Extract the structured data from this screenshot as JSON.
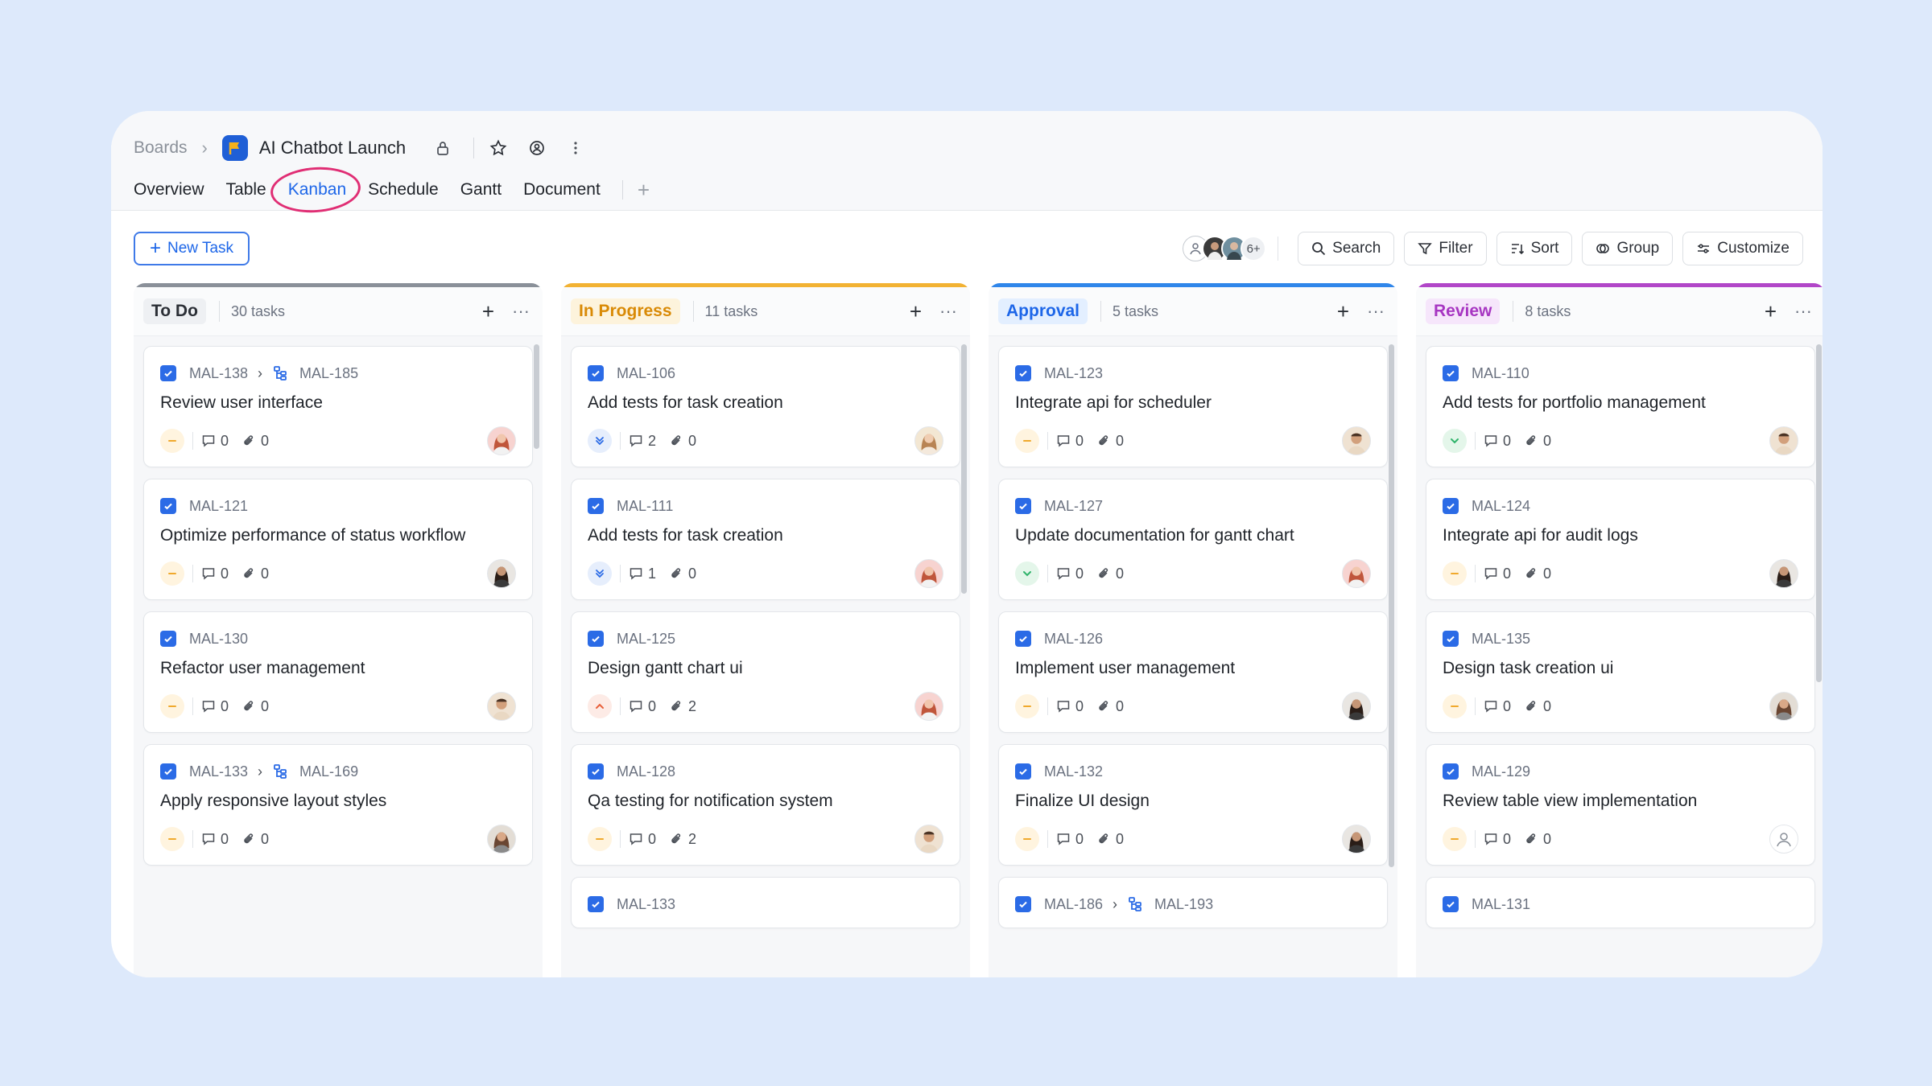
{
  "header": {
    "breadcrumb_root": "Boards",
    "project_title": "AI Chatbot Launch",
    "tabs": [
      {
        "label": "Overview"
      },
      {
        "label": "Table"
      },
      {
        "label": "Kanban"
      },
      {
        "label": "Schedule"
      },
      {
        "label": "Gantt"
      },
      {
        "label": "Document"
      }
    ],
    "active_tab": "Kanban"
  },
  "toolbar": {
    "new_task": "New Task",
    "members_more": "6+",
    "search": "Search",
    "filter": "Filter",
    "sort": "Sort",
    "group": "Group",
    "customize": "Customize"
  },
  "colors": {
    "accent": "#1d66e8",
    "todo": "#8a9099",
    "in_progress": "#f2b233",
    "approval": "#2f86ea",
    "review": "#b146c8",
    "annotation": "#e02e74"
  },
  "columns": [
    {
      "status": "To Do",
      "count": "30 tasks",
      "cards": [
        {
          "id": "MAL-138",
          "parent": "MAL-185",
          "title": "Review user interface",
          "priority": "medium",
          "comments": "0",
          "attachments": "0",
          "avatar": "woman-pink"
        },
        {
          "id": "MAL-121",
          "title": "Optimize performance of status workflow",
          "priority": "medium",
          "comments": "0",
          "attachments": "0",
          "avatar": "woman-dark"
        },
        {
          "id": "MAL-130",
          "title": "Refactor user management",
          "priority": "medium",
          "comments": "0",
          "attachments": "0",
          "avatar": "man-tan"
        },
        {
          "id": "MAL-133",
          "parent": "MAL-169",
          "title": "Apply responsive layout styles",
          "priority": "medium",
          "comments": "0",
          "attachments": "0",
          "avatar": "woman-brown"
        }
      ]
    },
    {
      "status": "In Progress",
      "count": "11 tasks",
      "cards": [
        {
          "id": "MAL-106",
          "title": "Add tests for task creation",
          "priority": "lowest",
          "comments": "2",
          "attachments": "0",
          "avatar": "woman-blonde"
        },
        {
          "id": "MAL-111",
          "title": "Add tests for task creation",
          "priority": "lowest",
          "comments": "1",
          "attachments": "0",
          "avatar": "woman-pink"
        },
        {
          "id": "MAL-125",
          "title": "Design gantt chart ui",
          "priority": "high",
          "comments": "0",
          "attachments": "2",
          "avatar": "woman-pink"
        },
        {
          "id": "MAL-128",
          "title": "Qa testing for notification system",
          "priority": "medium",
          "comments": "0",
          "attachments": "2",
          "avatar": "man-tan"
        },
        {
          "id": "MAL-133",
          "title": "",
          "priority": "",
          "comments": "",
          "attachments": "",
          "avatar": ""
        }
      ]
    },
    {
      "status": "Approval",
      "count": "5 tasks",
      "cards": [
        {
          "id": "MAL-123",
          "title": "Integrate api for scheduler",
          "priority": "medium",
          "comments": "0",
          "attachments": "0",
          "avatar": "man-tan"
        },
        {
          "id": "MAL-127",
          "title": "Update documentation for gantt chart",
          "priority": "low",
          "comments": "0",
          "attachments": "0",
          "avatar": "woman-pink"
        },
        {
          "id": "MAL-126",
          "title": "Implement user management",
          "priority": "medium",
          "comments": "0",
          "attachments": "0",
          "avatar": "woman-dark"
        },
        {
          "id": "MAL-132",
          "title": "Finalize UI design",
          "priority": "medium",
          "comments": "0",
          "attachments": "0",
          "avatar": "woman-dark"
        },
        {
          "id": "MAL-186",
          "parent": "MAL-193",
          "title": "",
          "priority": "",
          "comments": "",
          "attachments": "",
          "avatar": ""
        }
      ]
    },
    {
      "status": "Review",
      "count": "8 tasks",
      "cards": [
        {
          "id": "MAL-110",
          "title": "Add tests for portfolio management",
          "priority": "low",
          "comments": "0",
          "attachments": "0",
          "avatar": "man-tan"
        },
        {
          "id": "MAL-124",
          "title": "Integrate api for audit logs",
          "priority": "medium",
          "comments": "0",
          "attachments": "0",
          "avatar": "woman-dark"
        },
        {
          "id": "MAL-135",
          "title": "Design task creation ui",
          "priority": "medium",
          "comments": "0",
          "attachments": "0",
          "avatar": "woman-brown"
        },
        {
          "id": "MAL-129",
          "title": "Review table view implementation",
          "priority": "medium",
          "comments": "0",
          "attachments": "0",
          "avatar": "unassigned"
        },
        {
          "id": "MAL-131",
          "title": "",
          "priority": "",
          "comments": "",
          "attachments": "",
          "avatar": ""
        }
      ]
    }
  ]
}
